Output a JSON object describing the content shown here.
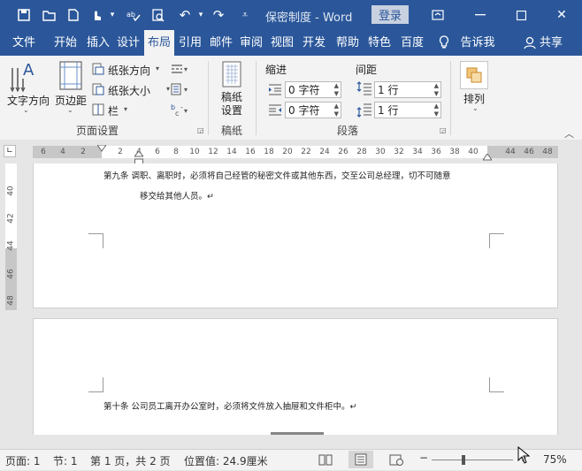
{
  "titlebar": {
    "doc_title": "保密制度 - Word",
    "login_label": "登录"
  },
  "tabs": [
    "文件",
    "开始",
    "插入",
    "设计",
    "布局",
    "引用",
    "邮件",
    "审阅",
    "视图",
    "开发",
    "帮助",
    "特色",
    "百度",
    "告诉我",
    "共享"
  ],
  "ribbon": {
    "text_direction": "文字方向",
    "margins": "页边距",
    "orientation": "纸张方向",
    "size": "纸张大小",
    "columns": "栏",
    "page_setup_label": "页面设置",
    "paper_setup": "稿纸\n设置",
    "paper_label": "稿纸",
    "indent_label": "缩进",
    "spacing_label": "间距",
    "indent_left": "0 字符",
    "indent_right": "0 字符",
    "spacing_before": "1 行",
    "spacing_after": "1 行",
    "paragraph_label": "段落",
    "arrange": "排列"
  },
  "ruler": {
    "h_numbers": [
      "6",
      "4",
      "2",
      "2",
      "4",
      "6",
      "8",
      "10",
      "12",
      "14",
      "16",
      "18",
      "20",
      "22",
      "24",
      "26",
      "28",
      "30",
      "32",
      "34",
      "36",
      "38",
      "40",
      "44",
      "46",
      "48"
    ],
    "v_numbers": [
      "40",
      "42",
      "44",
      "46",
      "48"
    ]
  },
  "document": {
    "article9_line1": "第九条 调职、离职时，必须将自己经管的秘密文件或其他东西，交至公司总经理，切不可随意",
    "article9_line2": "移交给其他人员。↵",
    "article10": "第十条 公司员工离开办公室时，必须将文件放入抽屉和文件柜中。↵"
  },
  "statusbar": {
    "page": "页面: 1",
    "section": "节: 1",
    "page_of": "第 1 页，共 2 页",
    "position": "位置值: 24.9厘米",
    "zoom": "75%"
  }
}
